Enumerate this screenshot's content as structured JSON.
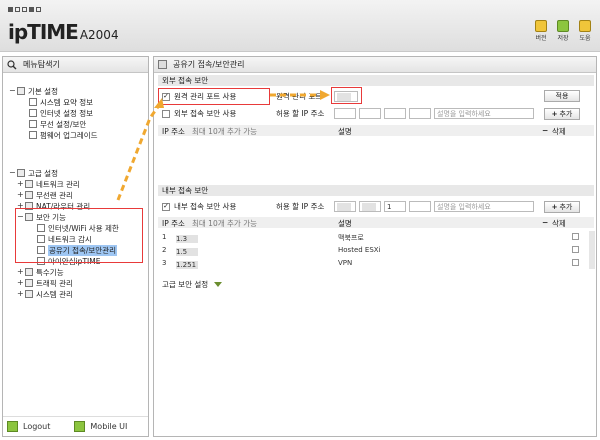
{
  "header": {
    "brand_main": "ipTIME",
    "brand_model": "A2004",
    "buttons": [
      {
        "label": "버전",
        "icon": "info-icon"
      },
      {
        "label": "저장",
        "icon": "save-icon"
      },
      {
        "label": "도움",
        "icon": "help-icon"
      }
    ]
  },
  "sidebar": {
    "title": "메뉴탐색기",
    "basic": {
      "label": "기본 설정",
      "items": [
        "시스템 요약 정보",
        "인터넷 설정 정보",
        "무선 설정/보안",
        "펌웨어 업그레이드"
      ]
    },
    "advanced": {
      "label": "고급 설정",
      "items": [
        {
          "label": "네트워크 관리"
        },
        {
          "label": "무선랜 관리"
        },
        {
          "label": "NAT/라우터 관리"
        },
        {
          "label": "보안 기능",
          "children": [
            "인터넷/WiFi 사용 제한",
            "네트워크 감시",
            "공유기 접속/보안관리",
            "아이안심ipTIME"
          ]
        },
        {
          "label": "특수기능"
        },
        {
          "label": "트래픽 관리"
        },
        {
          "label": "시스템 관리"
        }
      ]
    },
    "footer": {
      "logout": "Logout",
      "mobile": "Mobile UI"
    }
  },
  "main": {
    "title": "공유기 접속/보안관리",
    "external": {
      "header": "외부 접속 보안",
      "remote_port_checkbox": "원격 관리 포트 사용",
      "remote_port_label": "원격 관리 포트",
      "apply_button": "적용",
      "allow_checkbox": "외부 접속 보안 사용",
      "allow_ip_label": "허용 할 IP 주소",
      "desc_placeholder": "설명을 입력하세요",
      "add_button": "추가",
      "col_ip": "IP 주소",
      "col_max": "최대 10개 추가 가능",
      "col_desc": "설명",
      "col_delete": "삭제"
    },
    "internal": {
      "header": "내부 접속 보안",
      "allow_checkbox": "내부 접속 보안 사용",
      "allow_ip_label": "허용 할 IP 주소",
      "ip_oct3": "1",
      "desc_placeholder": "설명을 입력하세요",
      "add_button": "추가",
      "col_ip": "IP 주소",
      "col_max": "최대 10개 추가 가능",
      "col_desc": "설명",
      "col_delete": "삭제",
      "rows": [
        {
          "no": "1",
          "ip_suffix": "1.3",
          "desc": "맥북프로"
        },
        {
          "no": "2",
          "ip_suffix": "1.5",
          "desc": "Hosted ESXi"
        },
        {
          "no": "3",
          "ip_suffix": "1.251",
          "desc": "VPN"
        }
      ]
    },
    "advanced_security": "고급 보안 설정"
  },
  "colors": {
    "highlight": "#e83a3a",
    "arrow": "#f0a830",
    "selection": "#9ec6f3"
  }
}
